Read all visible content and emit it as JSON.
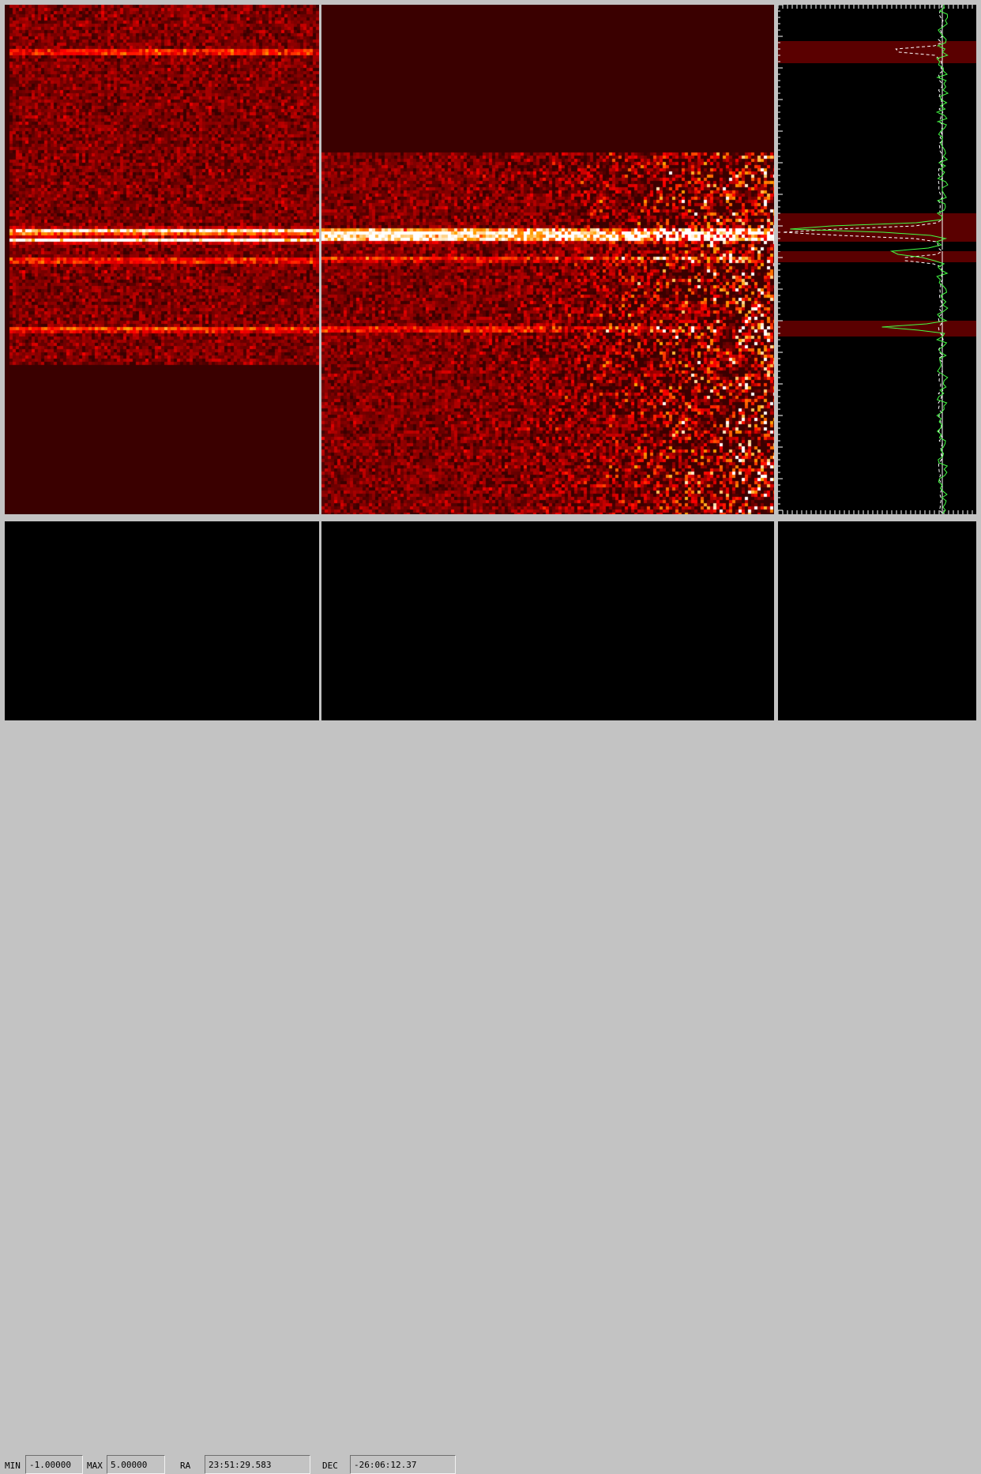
{
  "viewer": {
    "panels": [
      {
        "id": "left-spectrum-image",
        "kind": "image"
      },
      {
        "id": "main-spectrum-image",
        "kind": "image"
      },
      {
        "id": "spatial-profile-plot",
        "kind": "plot"
      },
      {
        "id": "lower-left-panel",
        "kind": "blank"
      },
      {
        "id": "lower-center-panel",
        "kind": "blank"
      },
      {
        "id": "lower-right-panel",
        "kind": "blank"
      }
    ],
    "colormap": "heat",
    "colors": {
      "background": "#c3c3c3",
      "image_background": "#3a0000",
      "profile_line": "#44ff44",
      "profile_dashed": "#ffffff",
      "highlight_band": "#5a0000"
    }
  },
  "controls": {
    "min_label": "MIN",
    "min_value": "-1.00000",
    "max_label": "MAX",
    "max_value": "5.00000",
    "ra_label": "RA",
    "ra_value": "23:51:29.583",
    "dec_label": "DEC",
    "dec_value": "-26:06:12.37"
  }
}
